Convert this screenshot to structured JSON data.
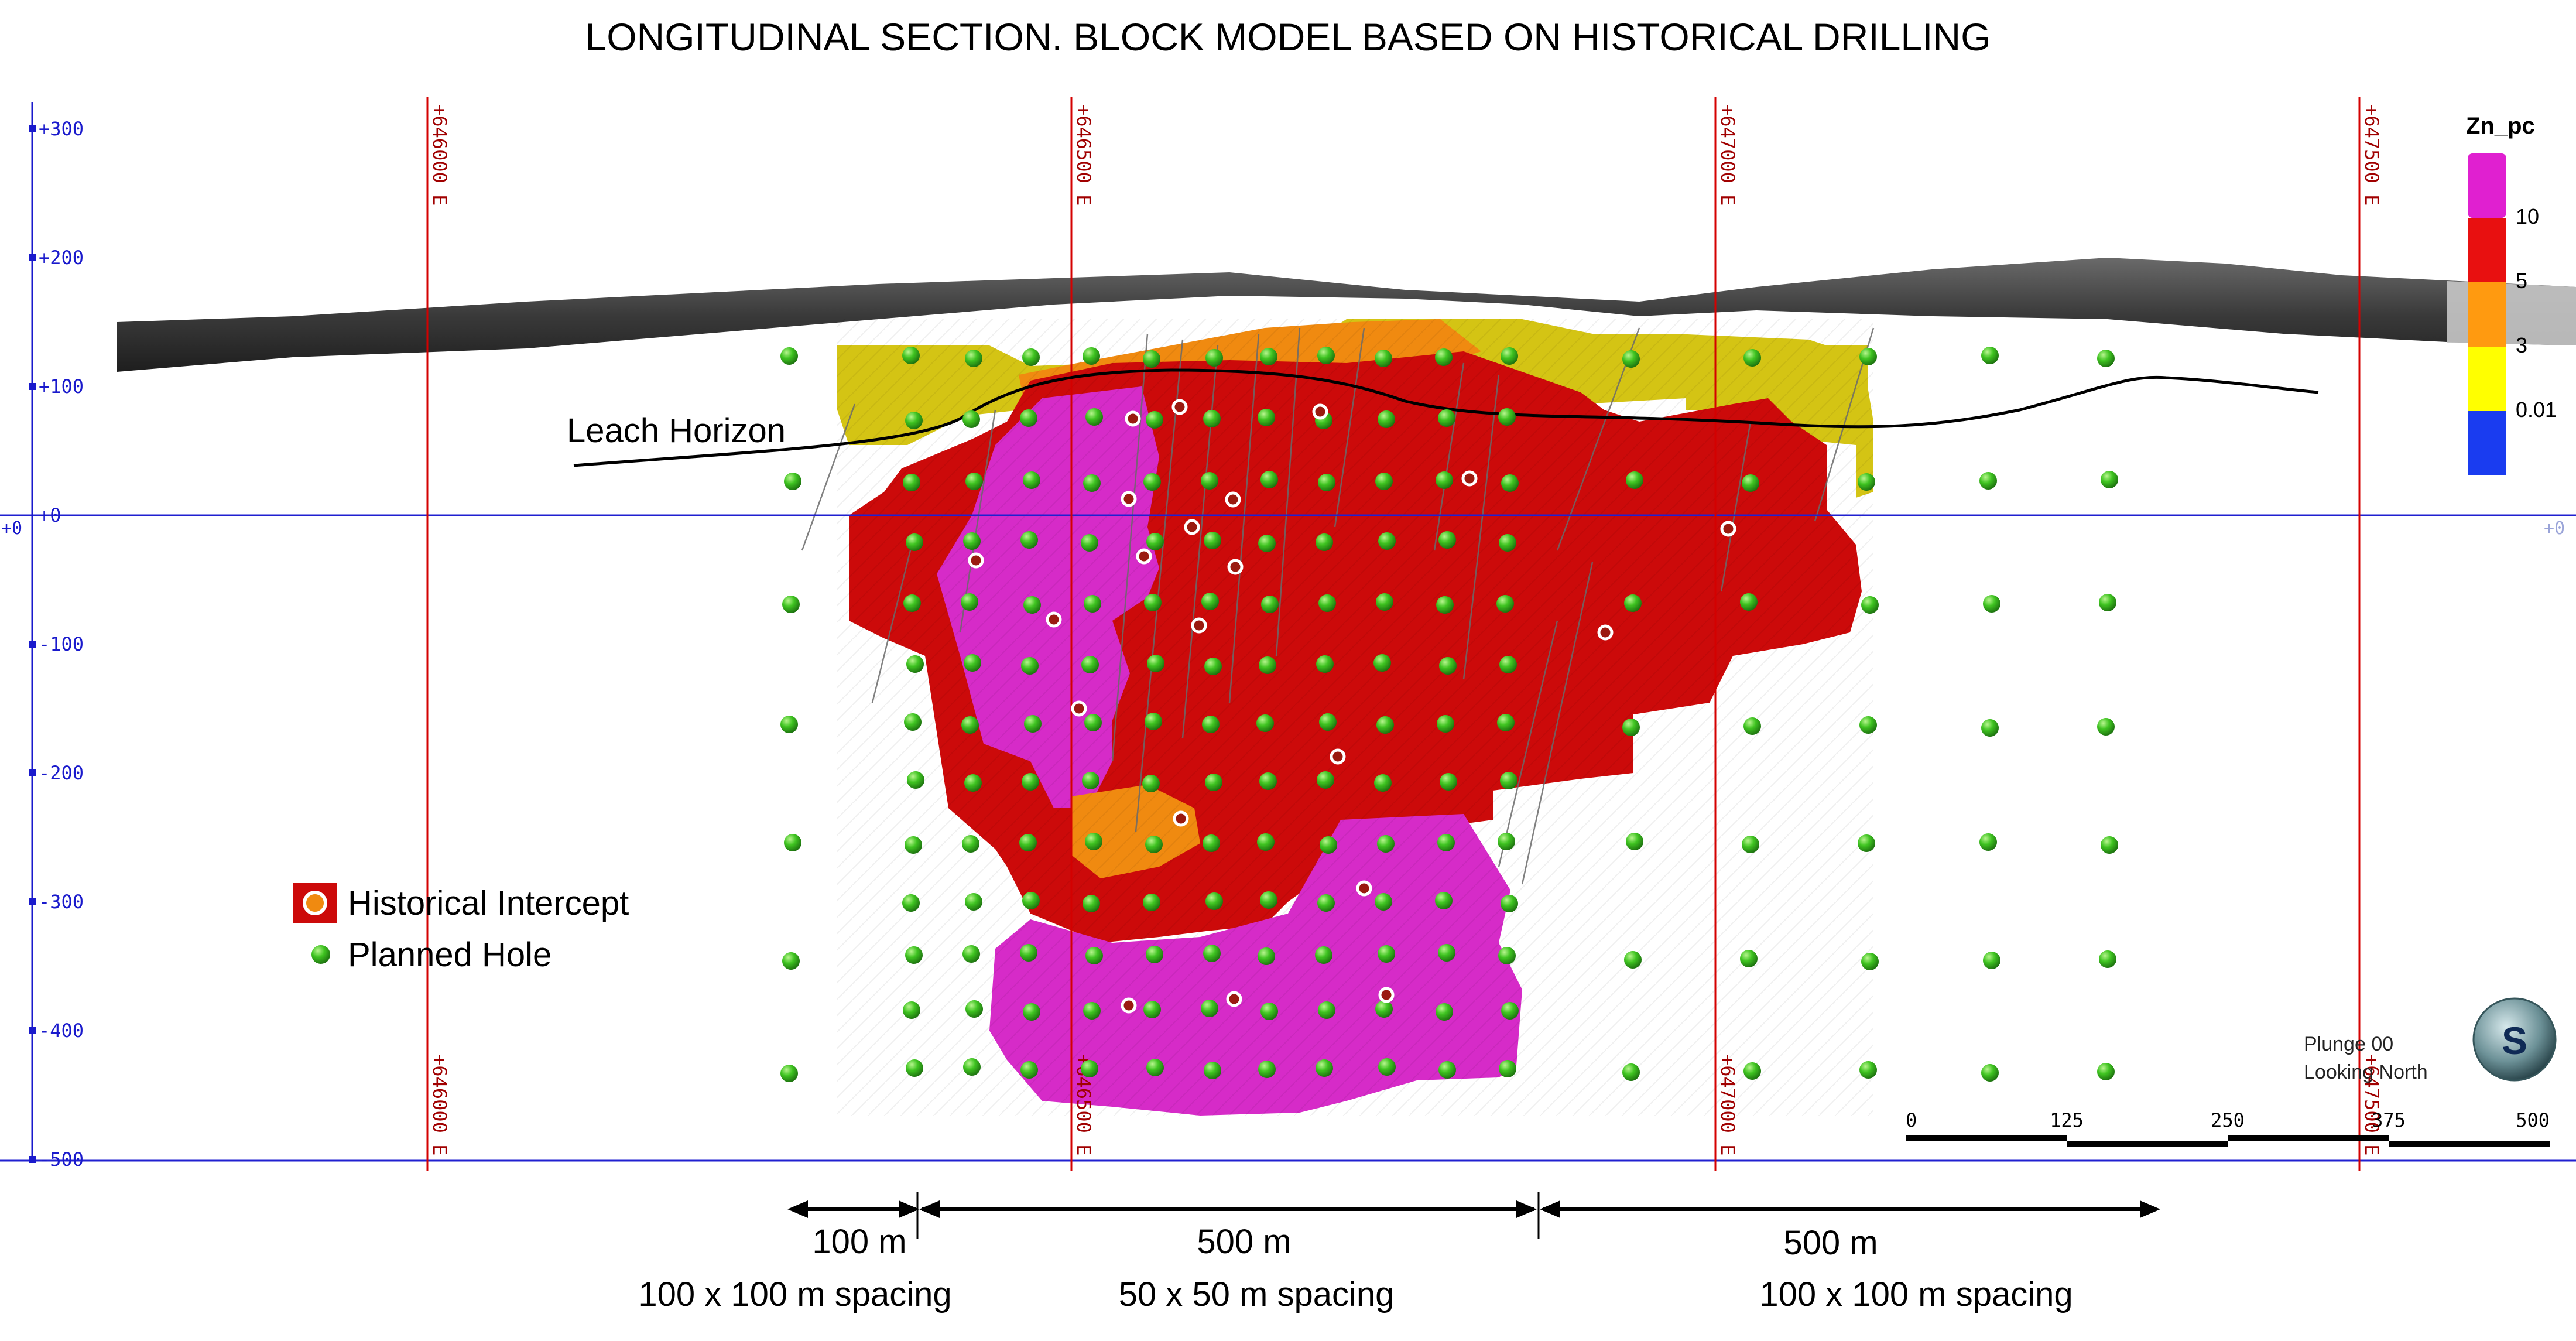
{
  "title": "LONGITUDINAL SECTION. BLOCK MODEL BASED ON HISTORICAL DRILLING",
  "y_axis": {
    "ticks": [
      {
        "value": 300,
        "label": "+300"
      },
      {
        "value": 200,
        "label": "+200"
      },
      {
        "value": 100,
        "label": "+100"
      },
      {
        "value": 0,
        "label": "+0"
      },
      {
        "value": -100,
        "label": "-100"
      },
      {
        "value": -200,
        "label": "-200"
      },
      {
        "value": -300,
        "label": "-300"
      },
      {
        "value": -400,
        "label": "-400"
      },
      {
        "value": -500,
        "label": "-500"
      }
    ],
    "zero_left_label": "+0",
    "zero_right_label": "+0"
  },
  "eastings": [
    {
      "value": 646000,
      "label": "+646000 E"
    },
    {
      "value": 646500,
      "label": "+646500 E"
    },
    {
      "value": 647000,
      "label": "+647000 E"
    },
    {
      "value": 647500,
      "label": "+647500 E"
    }
  ],
  "legend_color": {
    "title": "Zn_pc",
    "bands": [
      {
        "color": "#e020d0",
        "label": "10"
      },
      {
        "color": "#e81010",
        "label": "5"
      },
      {
        "color": "#ff9a10",
        "label": "3"
      },
      {
        "color": "#ffff00",
        "label": "0.01"
      },
      {
        "color": "#1a3cf0",
        "label": ""
      }
    ]
  },
  "leach_label": "Leach Horizon",
  "legend_symbols": {
    "intercept_label": "Historical Intercept",
    "planned_label": "Planned Hole"
  },
  "view_info": {
    "plunge": "Plunge 00",
    "looking": "Looking North"
  },
  "scalebar": {
    "labels": [
      "0",
      "125",
      "250",
      "375",
      "500"
    ]
  },
  "spacing": [
    {
      "distance": "100 m",
      "spacing": "100 x 100 m spacing"
    },
    {
      "distance": "500 m",
      "spacing": "50 x 50 m spacing"
    },
    {
      "distance": "500 m",
      "spacing": "100 x 100 m spacing"
    }
  ],
  "colors": {
    "magenta": "#d62bc8",
    "red": "#cc0a0a",
    "orange": "#f08a10",
    "yellow": "#d4c414",
    "grid_red": "#d40000",
    "axis_blue": "#1a1acc",
    "hole_green": "#3fc421"
  },
  "logo_letter": "S"
}
